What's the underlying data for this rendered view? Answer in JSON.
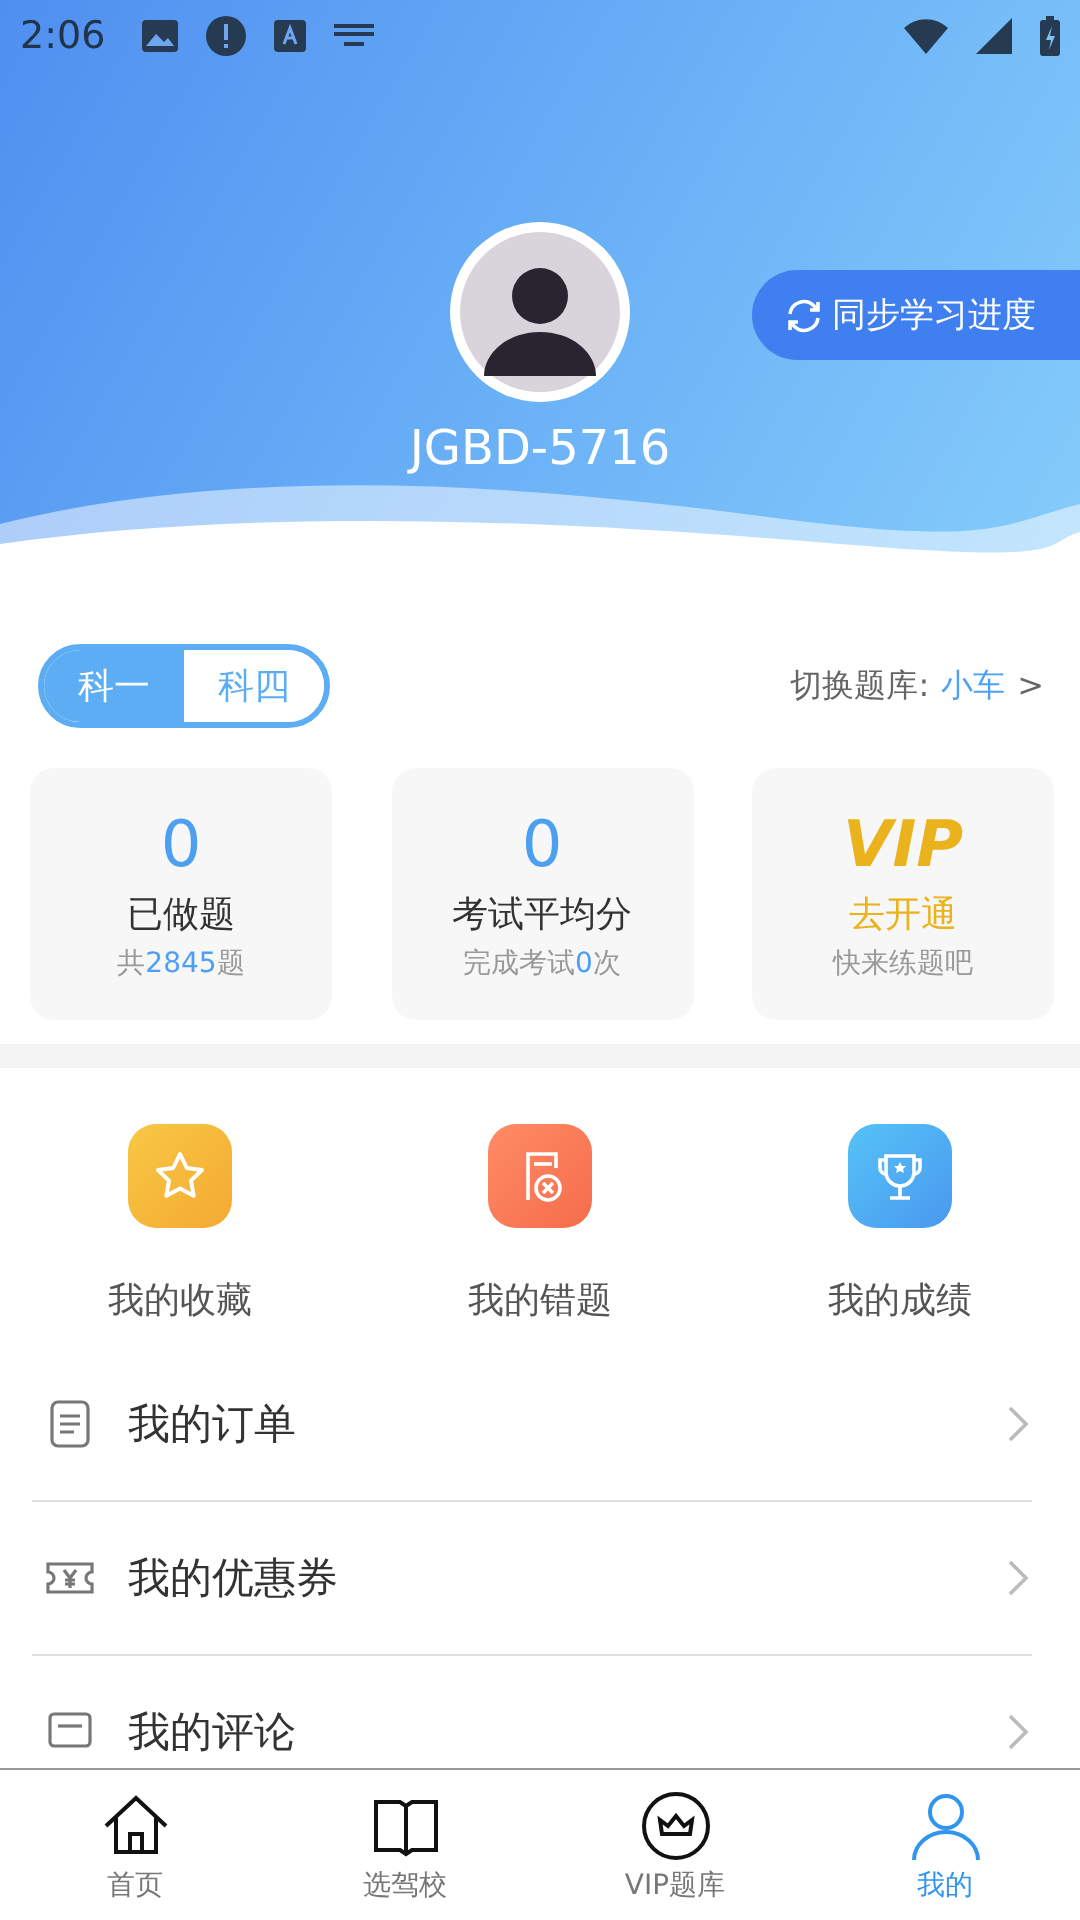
{
  "status_bar": {
    "time": "2:06"
  },
  "profile": {
    "username": "JGBD-5716",
    "sync_button": "同步学习进度"
  },
  "subject_tabs": [
    {
      "label": "科一",
      "selected": true
    },
    {
      "label": "科四",
      "selected": false
    }
  ],
  "bank_switch": {
    "label": "切换题库:",
    "value": "小车",
    "arrow": ">"
  },
  "stats": [
    {
      "kind": "number",
      "value": "0",
      "label": "已做题",
      "note": "共**2845**题"
    },
    {
      "kind": "number",
      "value": "0",
      "label": "考试平均分",
      "note": "完成考试**0**次"
    },
    {
      "kind": "vip",
      "value": "VIP",
      "label": "去开通",
      "note": "快来练题吧"
    }
  ],
  "shortcuts": [
    {
      "kind": "star",
      "label": "我的收藏"
    },
    {
      "kind": "wrong",
      "label": "我的错题"
    },
    {
      "kind": "trophy",
      "label": "我的成绩"
    }
  ],
  "menu": [
    {
      "kind": "order",
      "label": "我的订单"
    },
    {
      "kind": "coupon",
      "label": "我的优惠券"
    },
    {
      "kind": "comment",
      "label": "我的评论"
    }
  ],
  "tab_bar": [
    {
      "kind": "home",
      "label": "首页",
      "selected": false
    },
    {
      "kind": "book",
      "label": "选驾校",
      "selected": false
    },
    {
      "kind": "crown",
      "label": "VIP题库",
      "selected": false
    },
    {
      "kind": "person",
      "label": "我的",
      "selected": true
    }
  ]
}
